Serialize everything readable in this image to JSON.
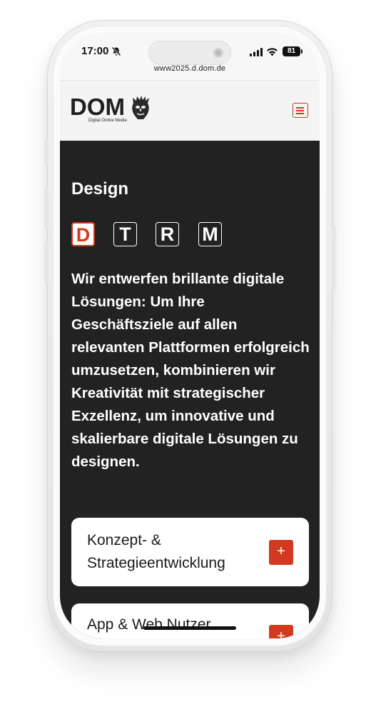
{
  "status": {
    "time": "17:00",
    "battery": "81"
  },
  "browser": {
    "url": "www2025.d.dom.de"
  },
  "header": {
    "logo": "DOM",
    "logo_sub": "Digital Online Media"
  },
  "main": {
    "title": "Design",
    "letters": [
      "D",
      "T",
      "R",
      "M"
    ],
    "intro": "Wir entwerfen brillante digitale Lösungen: Um Ihre Geschäftsziele auf allen relevanten Plattformen erfolgreich umzusetzen, kombinieren wir Kreativität mit strategischer Exzellenz, um innovative und skalierbare digitale Lösungen zu designen.",
    "accordion": [
      {
        "label": "Konzept- & Strategieentwicklung",
        "icon": "plus-icon"
      },
      {
        "label": "App & Web Nutzer",
        "icon": "plus-icon"
      }
    ]
  },
  "colors": {
    "accent": "#d23a1f",
    "background_dark": "#222222"
  }
}
